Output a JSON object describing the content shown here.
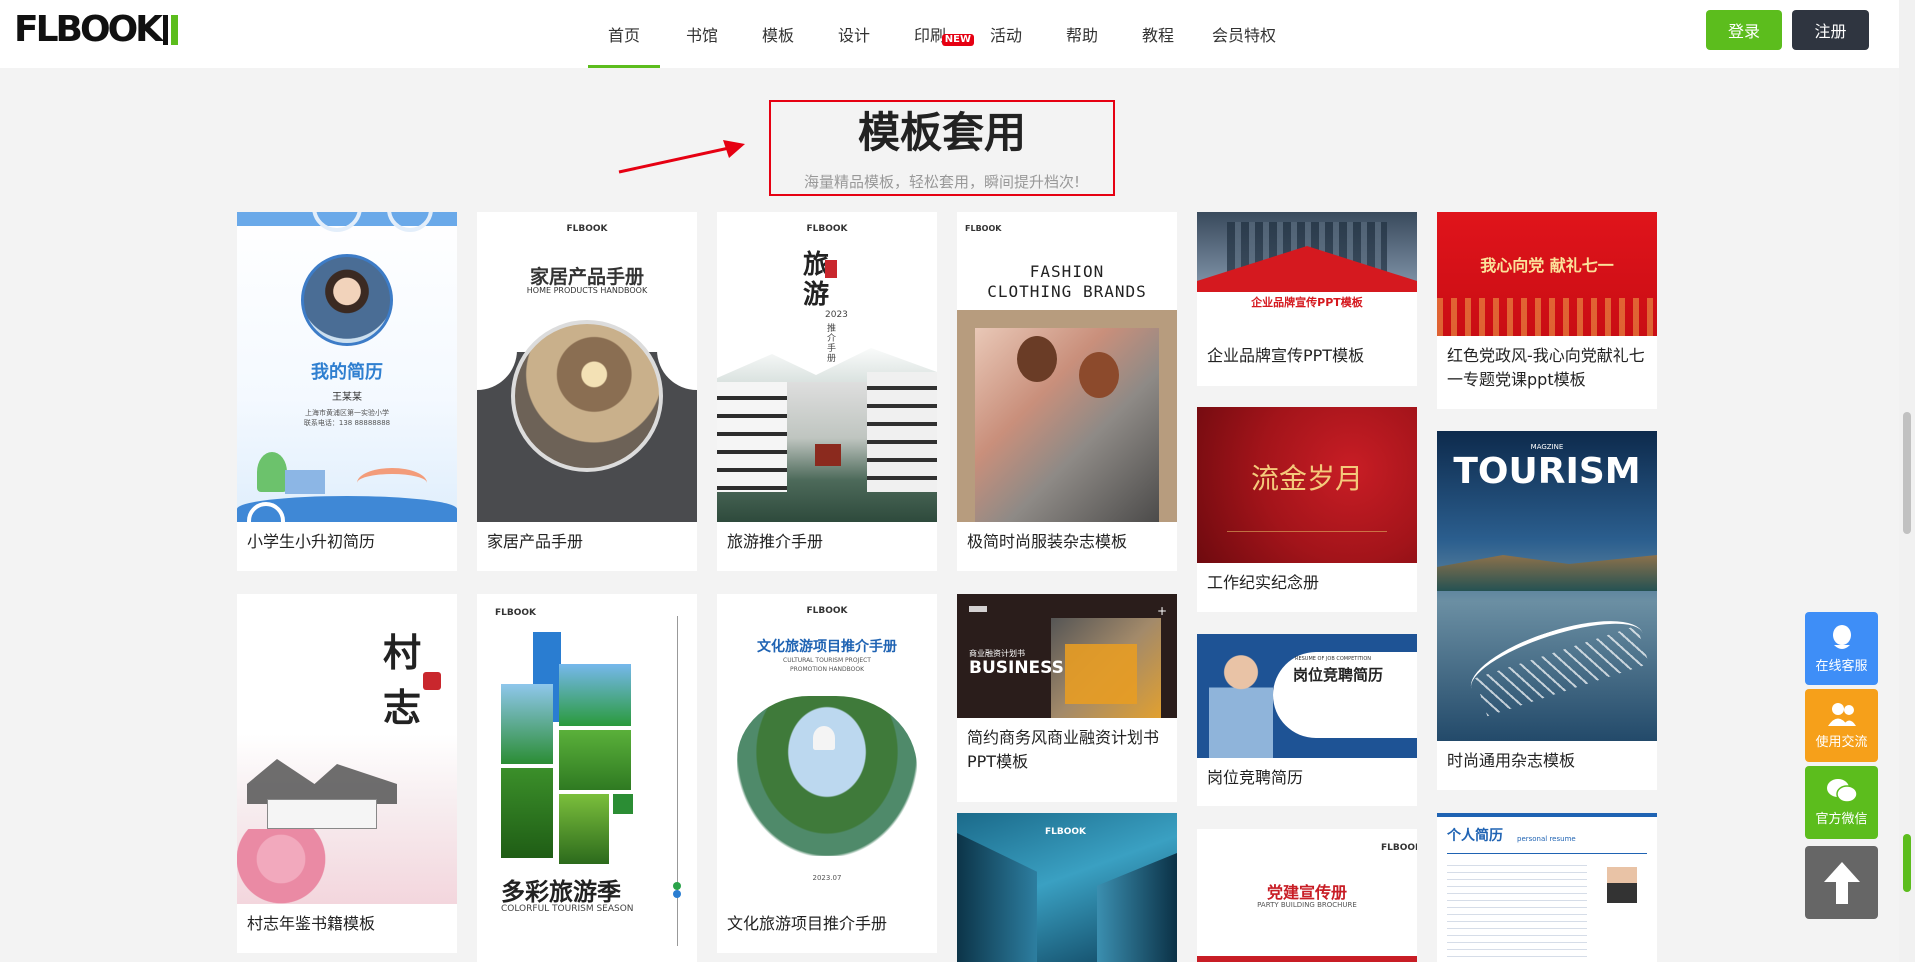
{
  "header": {
    "logo": "FLBOOK",
    "nav": [
      {
        "label": "首页",
        "active": true
      },
      {
        "label": "书馆"
      },
      {
        "label": "模板"
      },
      {
        "label": "设计"
      },
      {
        "label": "印刷",
        "badge": "NEW"
      },
      {
        "label": "活动"
      },
      {
        "label": "帮助"
      },
      {
        "label": "教程"
      },
      {
        "label": "会员特权"
      }
    ],
    "login": "登录",
    "register": "注册"
  },
  "section": {
    "title": "模板套用",
    "subtitle": "海量精品模板，轻松套用，瞬间提升档次!"
  },
  "cards": [
    {
      "label": "小学生小升初简历",
      "thumb": {
        "title": "我的简历",
        "name": "王某某",
        "line1": "上海市黄浦区第一实验小学",
        "line2": "联系电话：138 88888888"
      }
    },
    {
      "label": "家居产品手册",
      "thumb": {
        "brand": "FLBOOK",
        "title": "家居产品手册",
        "sub": "HOME PRODUCTS HANDBOOK"
      }
    },
    {
      "label": "旅游推介手册",
      "thumb": {
        "brand": "FLBOOK",
        "title": "旅游",
        "year": "2023",
        "sub": "推介手册"
      }
    },
    {
      "label": "极简时尚服装杂志模板",
      "thumb": {
        "brand": "FLBOOK",
        "title": "FASHION CLOTHING BRANDS"
      }
    },
    {
      "label": "企业品牌宣传PPT模板",
      "thumb": {
        "title": "企业品牌宣传PPT模板"
      }
    },
    {
      "label": "红色党政风-我心向党献礼七一专题党课ppt模板",
      "thumb": {
        "title": "我心向党 献礼七一"
      }
    },
    {
      "label": "工作纪实纪念册",
      "thumb": {
        "title": "流金岁月"
      }
    },
    {
      "label": "时尚通用杂志模板",
      "thumb": {
        "small": "MAGZINE",
        "title": "TOURISM"
      }
    },
    {
      "label": "村志年鉴书籍模板",
      "thumb": {
        "title": "村志"
      }
    },
    {
      "label": "",
      "thumb": {
        "brand": "FLBOOK",
        "title": "多彩旅游季",
        "sub": "COLORFUL TOURISM SEASON"
      }
    },
    {
      "label": "文化旅游项目推介手册",
      "thumb": {
        "brand": "FLBOOK",
        "title": "文化旅游项目推介手册",
        "sub": "CULTURAL TOURISM PROJECT PROMOTION HANDBOOK",
        "bottom": "2023.07"
      }
    },
    {
      "label": "简约商务风商业融资计划书PPT模板",
      "thumb": {
        "title": "BUSINESS",
        "small": "商业融资计划书"
      }
    },
    {
      "label": "岗位竞聘简历",
      "thumb": {
        "title": "岗位竞聘简历",
        "small": "RESUME OF JOB COMPETITION"
      }
    },
    {
      "label": "",
      "thumb": {
        "brand": "FLBOOK"
      }
    },
    {
      "label": "",
      "thumb": {
        "brand": "FLBOOK",
        "title": "党建宣传册",
        "sub": "PARTY BUILDING BROCHURE"
      }
    },
    {
      "label": "",
      "thumb": {
        "title": "个人简历",
        "sub": "personal resume"
      }
    }
  ],
  "float": [
    {
      "label": "在线客服",
      "icon": "chat-bubble-icon",
      "color": "#3e8ef7"
    },
    {
      "label": "使用交流",
      "icon": "users-icon",
      "color": "#f6a01a"
    },
    {
      "label": "官方微信",
      "icon": "wechat-icon",
      "color": "#5cbd1d"
    },
    {
      "label": "",
      "icon": "arrow-up-icon",
      "color": "#666666"
    }
  ]
}
